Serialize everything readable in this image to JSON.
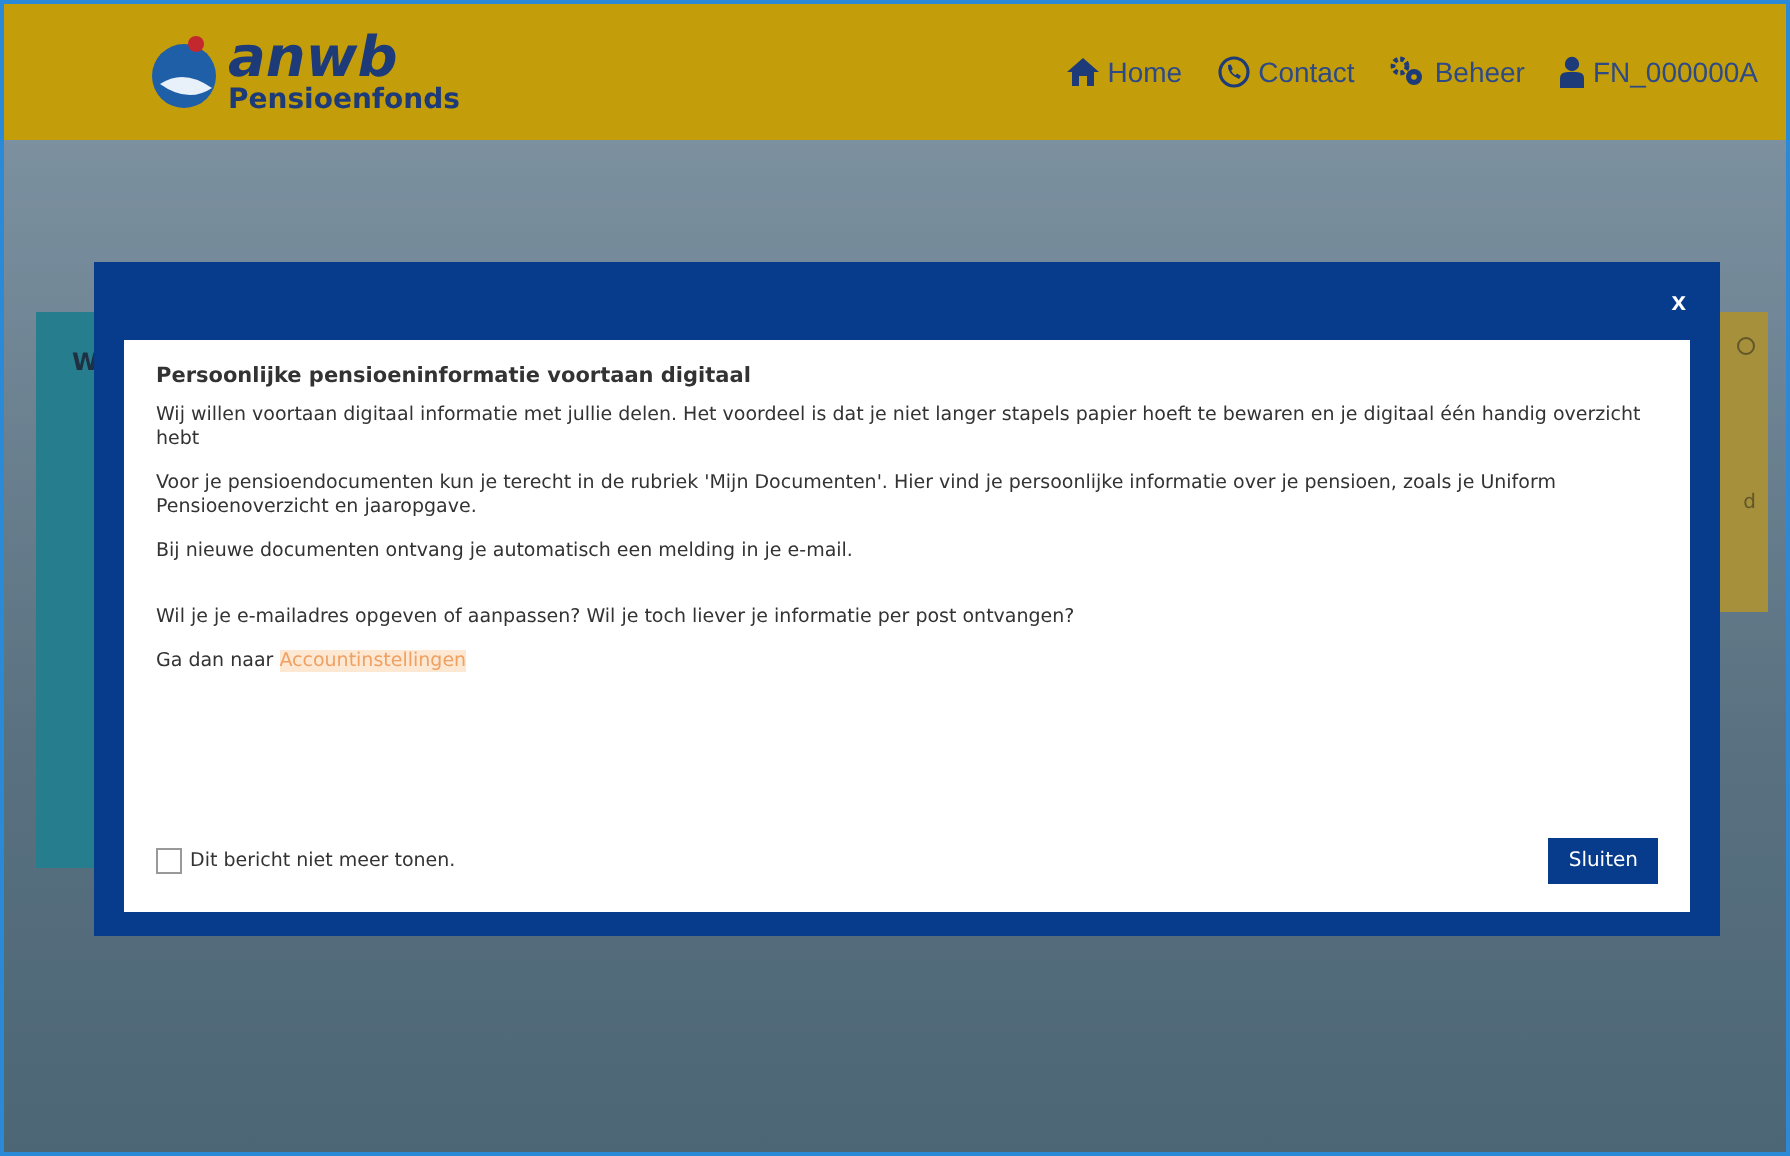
{
  "header": {
    "logo_word": "anwb",
    "logo_sub": "Pensioenfonds",
    "nav": [
      {
        "label": "Home",
        "kind": "home"
      },
      {
        "label": "Contact",
        "kind": "contact"
      },
      {
        "label": "Beheer",
        "kind": "admin"
      },
      {
        "label": "FN_000000A",
        "kind": "account"
      }
    ]
  },
  "background": {
    "left_card_text": "W",
    "right_card_text": "d"
  },
  "dialog": {
    "close": "x",
    "title": "Persoonlijke pensioeninformatie voortaan digitaal",
    "paragraphs": [
      "Wij willen voortaan digitaal informatie met jullie delen. Het voordeel is dat je niet langer stapels papier hoeft te bewaren en je digitaal één handig overzicht hebt",
      "Voor je pensioendocumenten kun je terecht in de rubriek 'Mijn Documenten'. Hier vind je persoonlijke informatie over je pensioen, zoals je Uniform Pensioenoverzicht en jaaropgave.",
      "Bij nieuwe documenten ontvang je automatisch een melding in je e-mail."
    ],
    "question": "Wil je je e-mailadres opgeven of aanpassen?  Wil je toch liever je informatie per post ontvangen?",
    "goto_text": "Ga dan naar",
    "link": "Accountinstellingen",
    "checkbox": {
      "label": "Dit bericht niet meer tonen.",
      "checked": false
    },
    "button": "Sluiten"
  }
}
